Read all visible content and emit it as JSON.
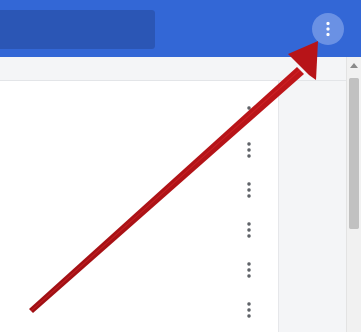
{
  "topbar": {
    "background": "#3367d6",
    "search_box_color": "#2b56b5",
    "menu_icon": "more-vert-icon"
  },
  "list": {
    "row_menu_icon": "more-vert-icon",
    "row_count": 6
  },
  "annotation": {
    "type": "arrow",
    "color": "#b71418",
    "points_to": "more-options-button"
  }
}
